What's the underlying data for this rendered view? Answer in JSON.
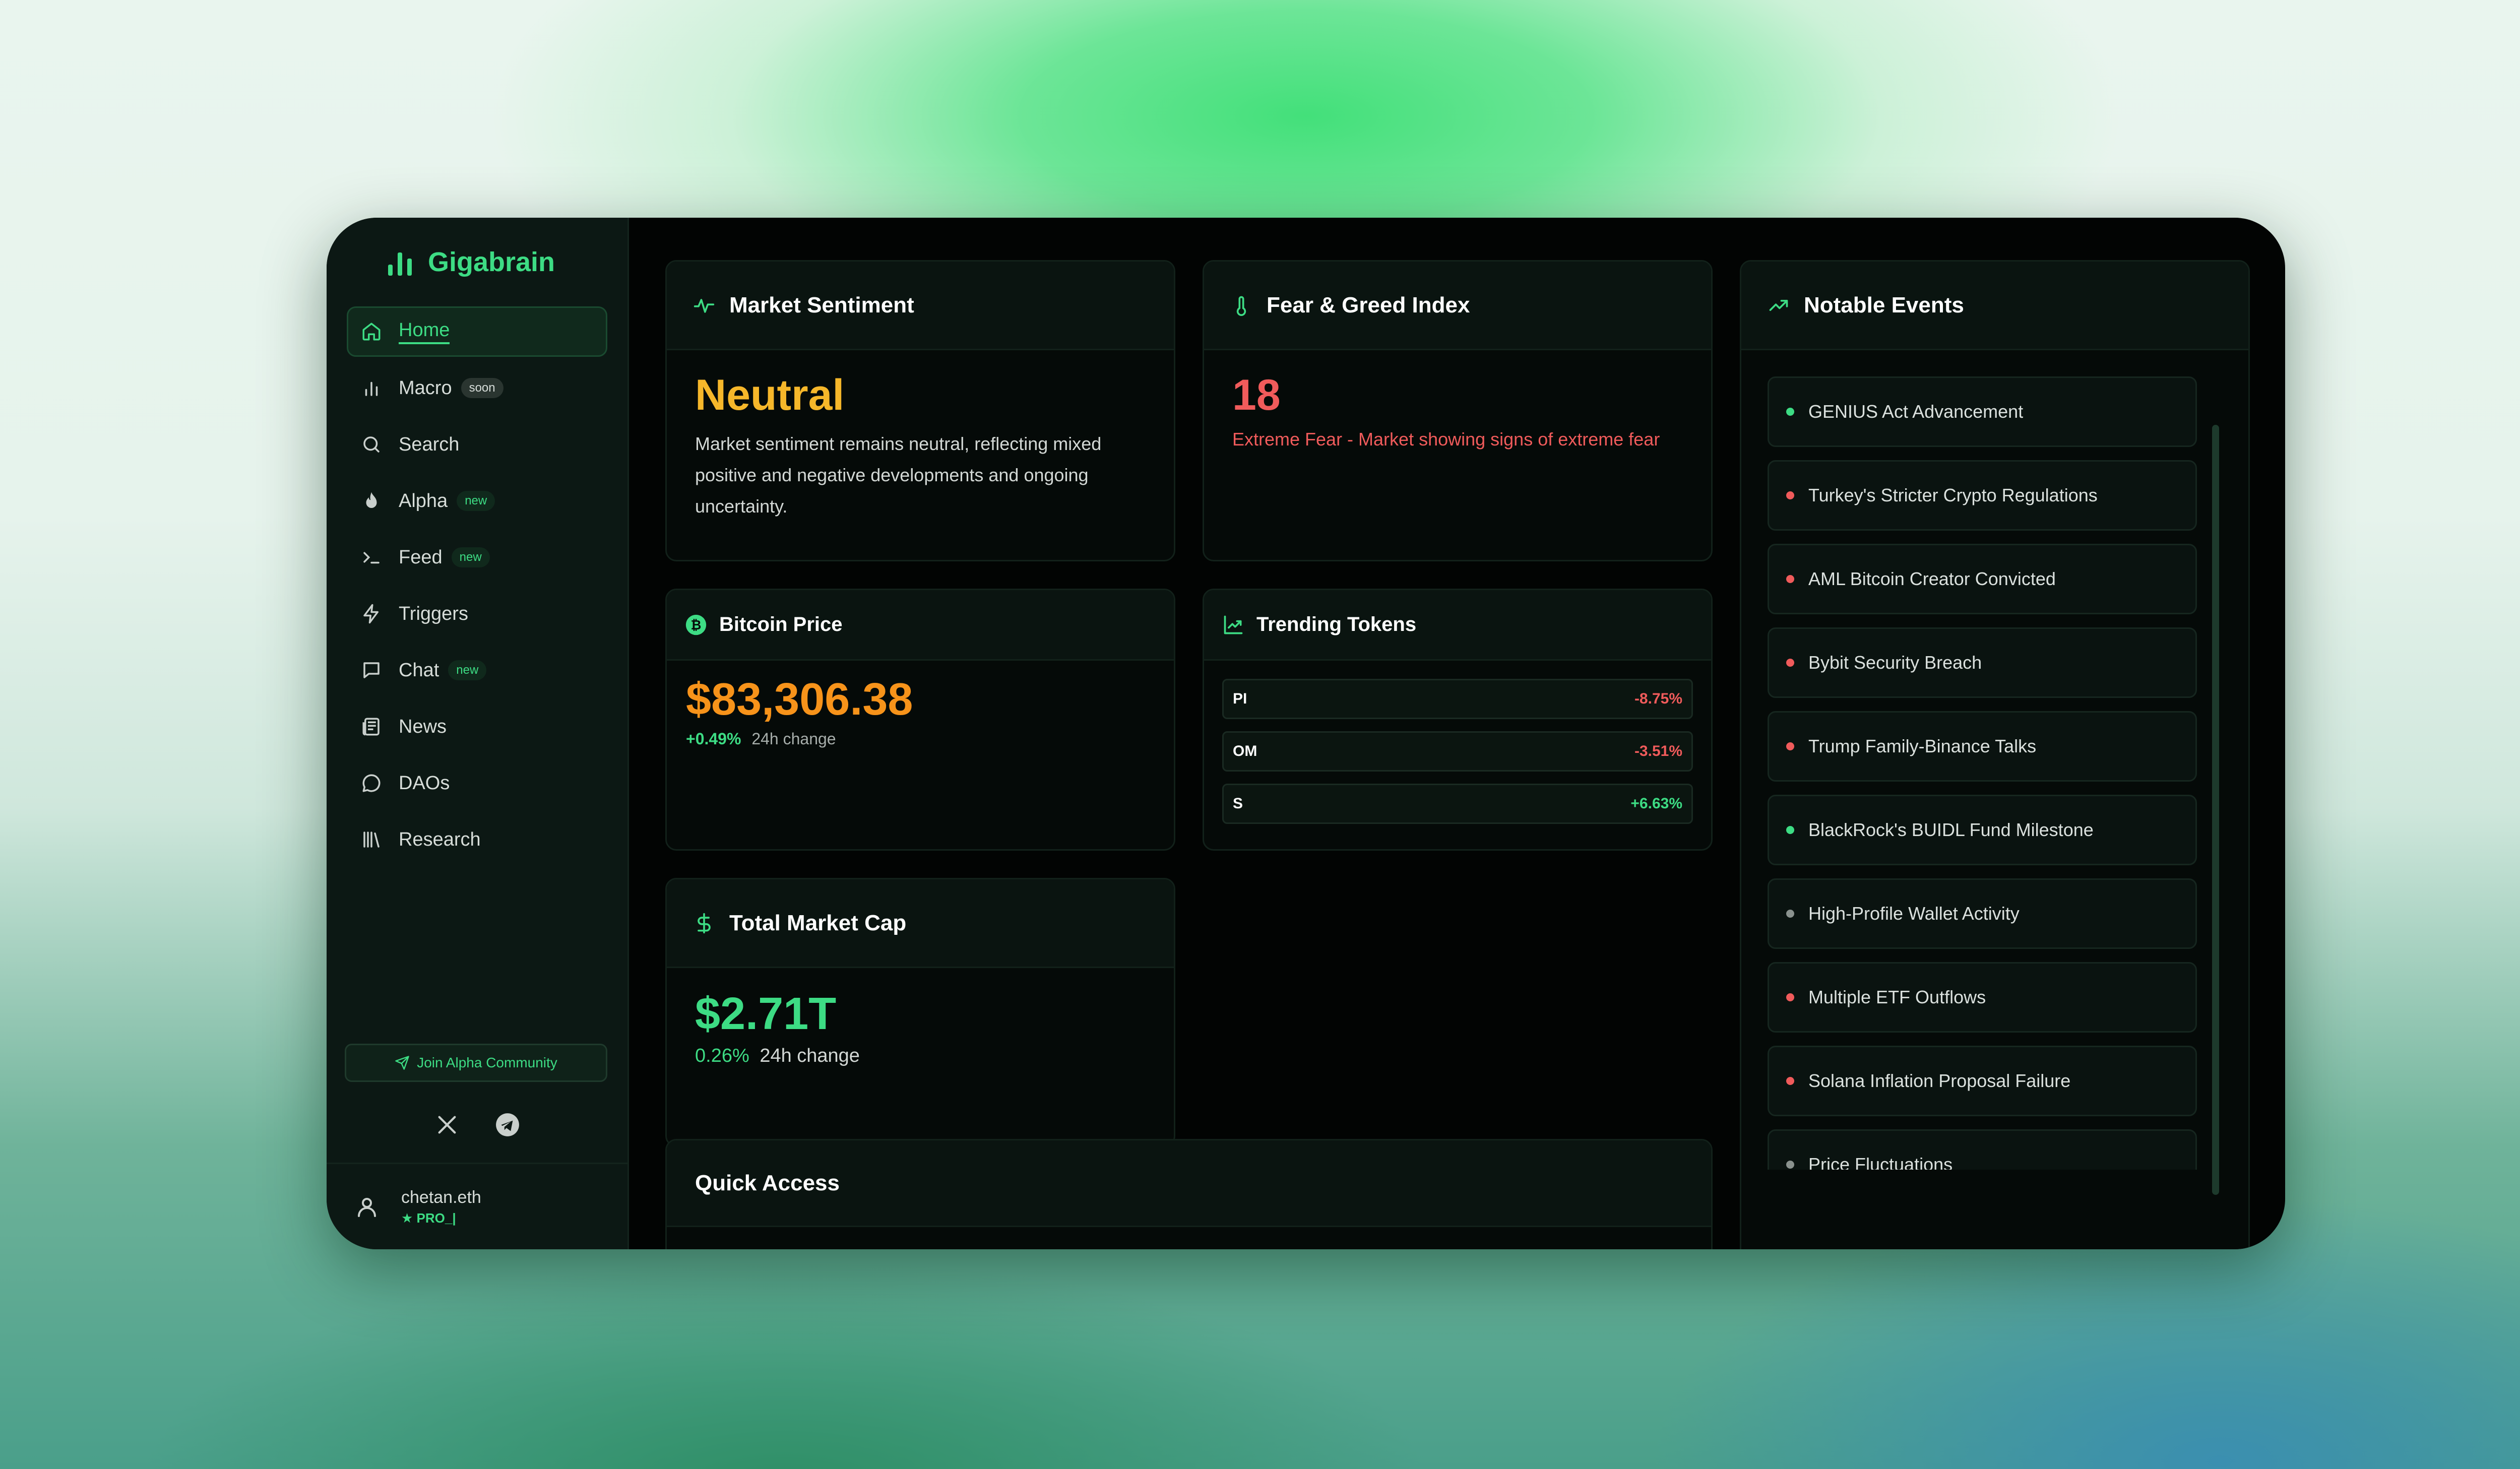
{
  "brand": {
    "name": "Gigabrain"
  },
  "sidebar": {
    "items": [
      {
        "label": "Home",
        "icon": "home-icon",
        "active": true
      },
      {
        "label": "Macro",
        "icon": "bar-chart-icon",
        "badge": "soon"
      },
      {
        "label": "Search",
        "icon": "search-icon"
      },
      {
        "label": "Alpha",
        "icon": "flame-icon",
        "badge": "new"
      },
      {
        "label": "Feed",
        "icon": "terminal-icon",
        "badge": "new"
      },
      {
        "label": "Triggers",
        "icon": "lightning-icon"
      },
      {
        "label": "Chat",
        "icon": "chat-square-icon",
        "badge": "new"
      },
      {
        "label": "News",
        "icon": "newspaper-icon"
      },
      {
        "label": "DAOs",
        "icon": "chat-circle-icon"
      },
      {
        "label": "Research",
        "icon": "library-icon"
      }
    ],
    "join_label": "Join Alpha Community",
    "socials": [
      "x-icon",
      "telegram-icon"
    ],
    "user": {
      "name": "chetan.eth",
      "plan": "PRO_|"
    }
  },
  "market_sentiment": {
    "title": "Market Sentiment",
    "value": "Neutral",
    "description": "Market sentiment remains neutral, reflecting mixed positive and negative developments and ongoing uncertainty."
  },
  "fear_greed": {
    "title": "Fear & Greed Index",
    "value": "18",
    "description": "Extreme Fear - Market showing signs of extreme fear"
  },
  "bitcoin": {
    "title": "Bitcoin Price",
    "price": "$83,306.38",
    "change": "+0.49%",
    "change_label": "24h change"
  },
  "trending": {
    "title": "Trending Tokens",
    "tokens": [
      {
        "symbol": "PI",
        "change": "-8.75%"
      },
      {
        "symbol": "OM",
        "change": "-3.51%"
      },
      {
        "symbol": "S",
        "change": "+6.63%"
      }
    ]
  },
  "market_cap": {
    "title": "Total Market Cap",
    "value": "$2.71T",
    "change": "0.26%",
    "change_label": "24h change"
  },
  "quick_access": {
    "title": "Quick Access"
  },
  "notable_events": {
    "title": "Notable Events",
    "items": [
      {
        "label": "GENIUS Act Advancement",
        "status": "green"
      },
      {
        "label": "Turkey's Stricter Crypto Regulations",
        "status": "red"
      },
      {
        "label": "AML Bitcoin Creator Convicted",
        "status": "red"
      },
      {
        "label": "Bybit Security Breach",
        "status": "red"
      },
      {
        "label": "Trump Family-Binance Talks",
        "status": "red"
      },
      {
        "label": "BlackRock's BUIDL Fund Milestone",
        "status": "green"
      },
      {
        "label": "High-Profile Wallet Activity",
        "status": "gray"
      },
      {
        "label": "Multiple ETF Outflows",
        "status": "red"
      },
      {
        "label": "Solana Inflation Proposal Failure",
        "status": "red"
      },
      {
        "label": "Price Fluctuations",
        "status": "gray"
      }
    ]
  },
  "colors": {
    "accent": "#3ddc84",
    "warning": "#f6b72a",
    "negative": "#f05b5b",
    "bitcoin": "#f7931a"
  }
}
